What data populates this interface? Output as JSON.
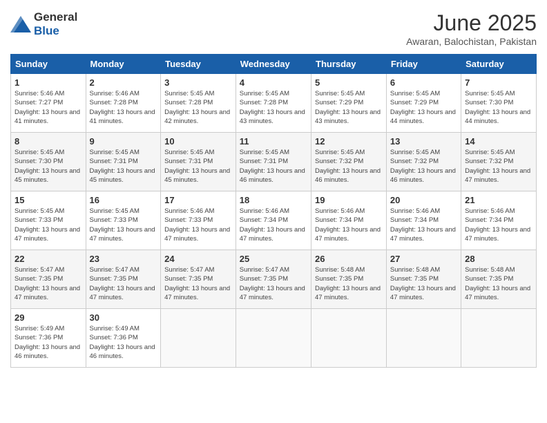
{
  "header": {
    "logo_general": "General",
    "logo_blue": "Blue",
    "month_title": "June 2025",
    "location": "Awaran, Balochistan, Pakistan"
  },
  "weekdays": [
    "Sunday",
    "Monday",
    "Tuesday",
    "Wednesday",
    "Thursday",
    "Friday",
    "Saturday"
  ],
  "weeks": [
    [
      {
        "day": "1",
        "sunrise": "5:46 AM",
        "sunset": "7:27 PM",
        "daylight": "13 hours and 41 minutes."
      },
      {
        "day": "2",
        "sunrise": "5:46 AM",
        "sunset": "7:28 PM",
        "daylight": "13 hours and 41 minutes."
      },
      {
        "day": "3",
        "sunrise": "5:45 AM",
        "sunset": "7:28 PM",
        "daylight": "13 hours and 42 minutes."
      },
      {
        "day": "4",
        "sunrise": "5:45 AM",
        "sunset": "7:28 PM",
        "daylight": "13 hours and 43 minutes."
      },
      {
        "day": "5",
        "sunrise": "5:45 AM",
        "sunset": "7:29 PM",
        "daylight": "13 hours and 43 minutes."
      },
      {
        "day": "6",
        "sunrise": "5:45 AM",
        "sunset": "7:29 PM",
        "daylight": "13 hours and 44 minutes."
      },
      {
        "day": "7",
        "sunrise": "5:45 AM",
        "sunset": "7:30 PM",
        "daylight": "13 hours and 44 minutes."
      }
    ],
    [
      {
        "day": "8",
        "sunrise": "5:45 AM",
        "sunset": "7:30 PM",
        "daylight": "13 hours and 45 minutes."
      },
      {
        "day": "9",
        "sunrise": "5:45 AM",
        "sunset": "7:31 PM",
        "daylight": "13 hours and 45 minutes."
      },
      {
        "day": "10",
        "sunrise": "5:45 AM",
        "sunset": "7:31 PM",
        "daylight": "13 hours and 45 minutes."
      },
      {
        "day": "11",
        "sunrise": "5:45 AM",
        "sunset": "7:31 PM",
        "daylight": "13 hours and 46 minutes."
      },
      {
        "day": "12",
        "sunrise": "5:45 AM",
        "sunset": "7:32 PM",
        "daylight": "13 hours and 46 minutes."
      },
      {
        "day": "13",
        "sunrise": "5:45 AM",
        "sunset": "7:32 PM",
        "daylight": "13 hours and 46 minutes."
      },
      {
        "day": "14",
        "sunrise": "5:45 AM",
        "sunset": "7:32 PM",
        "daylight": "13 hours and 47 minutes."
      }
    ],
    [
      {
        "day": "15",
        "sunrise": "5:45 AM",
        "sunset": "7:33 PM",
        "daylight": "13 hours and 47 minutes."
      },
      {
        "day": "16",
        "sunrise": "5:45 AM",
        "sunset": "7:33 PM",
        "daylight": "13 hours and 47 minutes."
      },
      {
        "day": "17",
        "sunrise": "5:46 AM",
        "sunset": "7:33 PM",
        "daylight": "13 hours and 47 minutes."
      },
      {
        "day": "18",
        "sunrise": "5:46 AM",
        "sunset": "7:34 PM",
        "daylight": "13 hours and 47 minutes."
      },
      {
        "day": "19",
        "sunrise": "5:46 AM",
        "sunset": "7:34 PM",
        "daylight": "13 hours and 47 minutes."
      },
      {
        "day": "20",
        "sunrise": "5:46 AM",
        "sunset": "7:34 PM",
        "daylight": "13 hours and 47 minutes."
      },
      {
        "day": "21",
        "sunrise": "5:46 AM",
        "sunset": "7:34 PM",
        "daylight": "13 hours and 47 minutes."
      }
    ],
    [
      {
        "day": "22",
        "sunrise": "5:47 AM",
        "sunset": "7:35 PM",
        "daylight": "13 hours and 47 minutes."
      },
      {
        "day": "23",
        "sunrise": "5:47 AM",
        "sunset": "7:35 PM",
        "daylight": "13 hours and 47 minutes."
      },
      {
        "day": "24",
        "sunrise": "5:47 AM",
        "sunset": "7:35 PM",
        "daylight": "13 hours and 47 minutes."
      },
      {
        "day": "25",
        "sunrise": "5:47 AM",
        "sunset": "7:35 PM",
        "daylight": "13 hours and 47 minutes."
      },
      {
        "day": "26",
        "sunrise": "5:48 AM",
        "sunset": "7:35 PM",
        "daylight": "13 hours and 47 minutes."
      },
      {
        "day": "27",
        "sunrise": "5:48 AM",
        "sunset": "7:35 PM",
        "daylight": "13 hours and 47 minutes."
      },
      {
        "day": "28",
        "sunrise": "5:48 AM",
        "sunset": "7:35 PM",
        "daylight": "13 hours and 47 minutes."
      }
    ],
    [
      {
        "day": "29",
        "sunrise": "5:49 AM",
        "sunset": "7:36 PM",
        "daylight": "13 hours and 46 minutes."
      },
      {
        "day": "30",
        "sunrise": "5:49 AM",
        "sunset": "7:36 PM",
        "daylight": "13 hours and 46 minutes."
      },
      null,
      null,
      null,
      null,
      null
    ]
  ]
}
